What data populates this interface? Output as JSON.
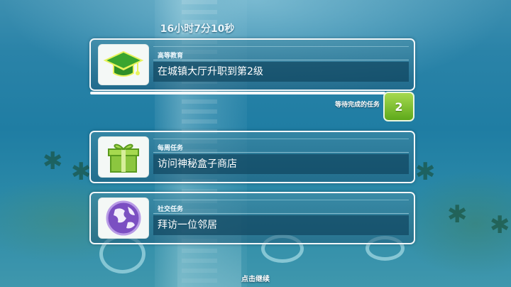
{
  "timer_text": "16小时7分10秒",
  "quests": [
    {
      "category": "高等教育",
      "task": "在城镇大厅升职到第2级",
      "icon": "graduation-cap-icon"
    },
    {
      "category": "每周任务",
      "task": "访问神秘盒子商店",
      "icon": "gift-box-icon"
    },
    {
      "category": "社交任务",
      "task": "拜访一位邻居",
      "icon": "globe-icon"
    }
  ],
  "pending": {
    "label": "等待完成的任务",
    "count": "2"
  },
  "continue_text": "点击继续",
  "colors": {
    "accent_green": "#7cc22e",
    "card_border": "#f2f7f9",
    "band": "#0f465f"
  }
}
